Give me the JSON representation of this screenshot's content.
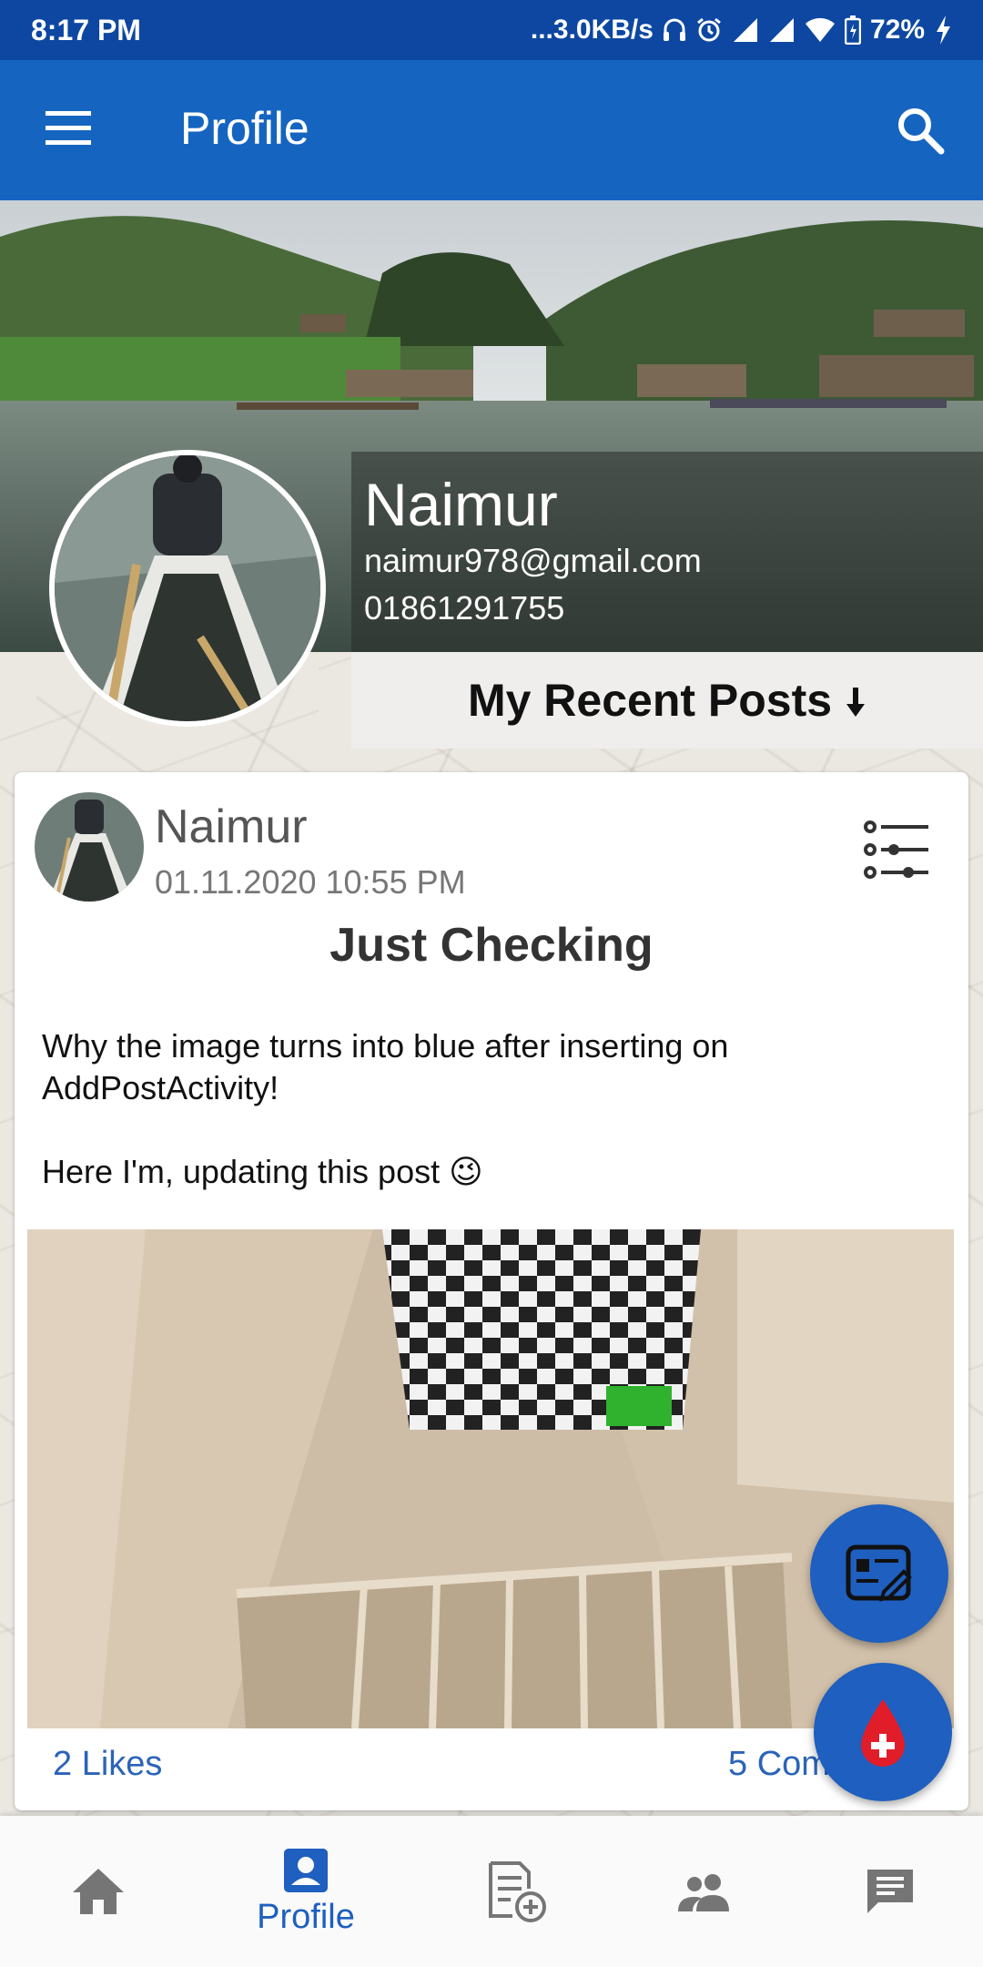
{
  "status_bar": {
    "time": "8:17 PM",
    "network_speed": "...3.0KB/s",
    "battery": "72%"
  },
  "app_bar": {
    "title": "Profile",
    "menu_icon": "menu-icon",
    "search_icon": "search-icon"
  },
  "profile": {
    "name": "Naimur",
    "email": "naimur978@gmail.com",
    "phone": "01861291755"
  },
  "recent_posts_header": "My Recent Posts",
  "post": {
    "author": "Naimur",
    "date": "01.11.2020 10:55 PM",
    "title": "Just Checking",
    "body": "Why the image turns into blue after inserting on AddPostActivity!\n\nHere I'm, updating this post 😉",
    "likes": "2 Likes",
    "comments": "5 Comments"
  },
  "bottom_nav": {
    "items": [
      {
        "icon": "home-icon",
        "label": ""
      },
      {
        "icon": "profile-icon",
        "label": "Profile",
        "active": true
      },
      {
        "icon": "add-post-icon",
        "label": ""
      },
      {
        "icon": "people-icon",
        "label": ""
      },
      {
        "icon": "chat-icon",
        "label": ""
      }
    ]
  },
  "colors": {
    "status_bar": "#0d47a1",
    "app_bar": "#1565c0",
    "accent": "#1e5fbf",
    "link": "#2b64b8"
  }
}
